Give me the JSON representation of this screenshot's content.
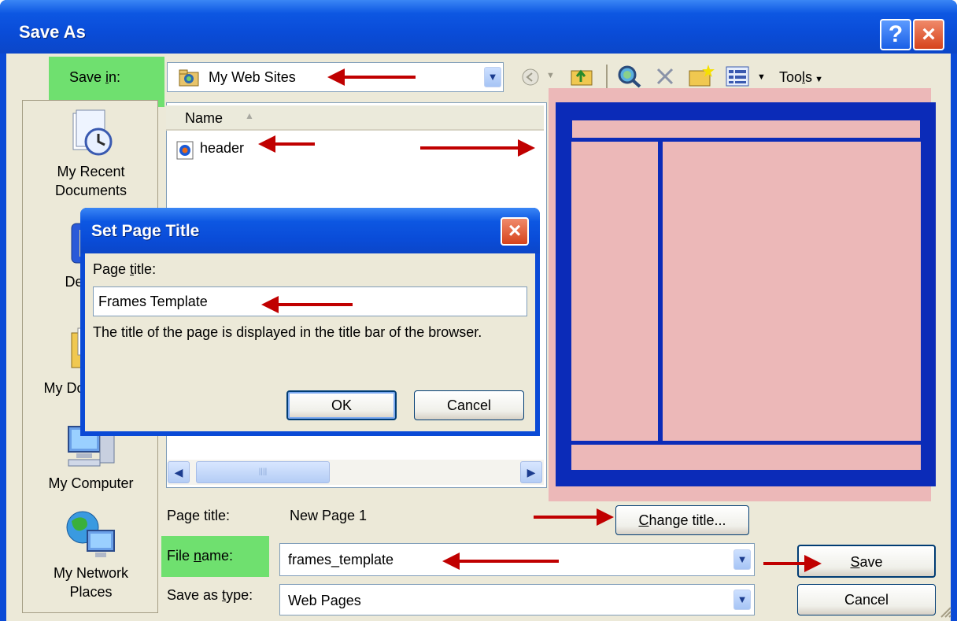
{
  "window": {
    "title": "Save As",
    "help_glyph": "?",
    "close_glyph": "×"
  },
  "toolbar": {
    "save_in_label_pre": "Save ",
    "save_in_label_key": "i",
    "save_in_label_post": "n:",
    "location": "My Web Sites",
    "tools_label_pre": "Too",
    "tools_label_key": "l",
    "tools_label_post": "s"
  },
  "places": [
    {
      "label": "My Recent Documents",
      "icon": "recent-documents-icon"
    },
    {
      "label": "Desktop",
      "icon": "desktop-icon"
    },
    {
      "label": "My Documents",
      "icon": "my-documents-icon"
    },
    {
      "label": "My Computer",
      "icon": "my-computer-icon"
    },
    {
      "label": "My Network Places",
      "icon": "network-places-icon"
    }
  ],
  "file_list": {
    "column_name": "Name",
    "items": [
      {
        "name": "header",
        "icon": "html-file-icon"
      }
    ]
  },
  "fields": {
    "page_title_label": "Page title:",
    "page_title_value": "New Page 1",
    "change_title_key": "C",
    "change_title_rest": "hange title...",
    "file_name_label_pre": "File ",
    "file_name_label_key": "n",
    "file_name_label_post": "ame:",
    "file_name_value": "frames_template",
    "save_type_label_pre": "Save as ",
    "save_type_label_key": "t",
    "save_type_label_post": "ype:",
    "save_type_value": "Web Pages",
    "save_key": "S",
    "save_rest": "ave",
    "cancel_label": "Cancel"
  },
  "dialog": {
    "title": "Set Page Title",
    "label_pre": "Page ",
    "label_key": "t",
    "label_post": "itle:",
    "value": "Frames Template",
    "description": "The title of the page is displayed in the title bar of the browser.",
    "ok_label": "OK",
    "cancel_label": "Cancel"
  },
  "colors": {
    "highlight": "#6fe06f",
    "arrow": "#c00000",
    "frame_border": "#0b2bb8",
    "frame_fill": "#ecb8b8"
  }
}
